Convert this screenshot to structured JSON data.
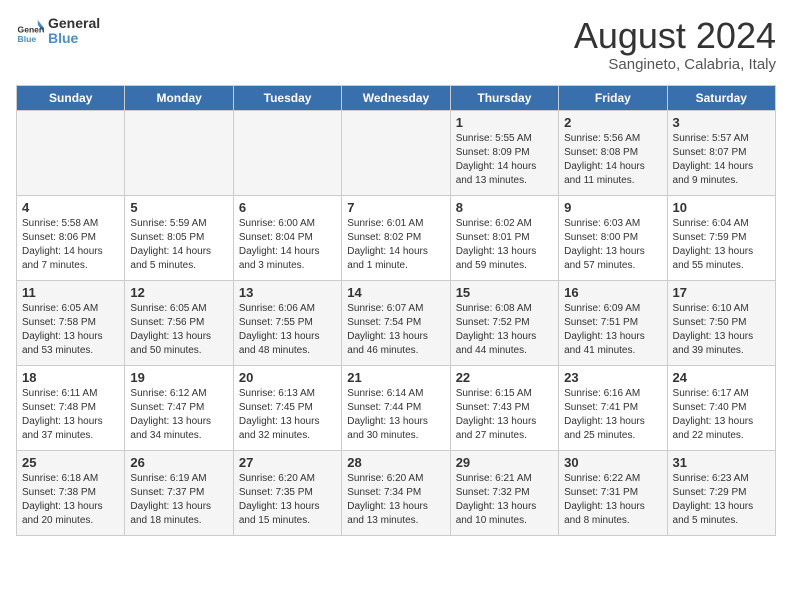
{
  "header": {
    "logo_line1": "General",
    "logo_line2": "Blue",
    "title": "August 2024",
    "subtitle": "Sangineto, Calabria, Italy"
  },
  "weekdays": [
    "Sunday",
    "Monday",
    "Tuesday",
    "Wednesday",
    "Thursday",
    "Friday",
    "Saturday"
  ],
  "weeks": [
    [
      {
        "day": "",
        "info": ""
      },
      {
        "day": "",
        "info": ""
      },
      {
        "day": "",
        "info": ""
      },
      {
        "day": "",
        "info": ""
      },
      {
        "day": "1",
        "info": "Sunrise: 5:55 AM\nSunset: 8:09 PM\nDaylight: 14 hours\nand 13 minutes."
      },
      {
        "day": "2",
        "info": "Sunrise: 5:56 AM\nSunset: 8:08 PM\nDaylight: 14 hours\nand 11 minutes."
      },
      {
        "day": "3",
        "info": "Sunrise: 5:57 AM\nSunset: 8:07 PM\nDaylight: 14 hours\nand 9 minutes."
      }
    ],
    [
      {
        "day": "4",
        "info": "Sunrise: 5:58 AM\nSunset: 8:06 PM\nDaylight: 14 hours\nand 7 minutes."
      },
      {
        "day": "5",
        "info": "Sunrise: 5:59 AM\nSunset: 8:05 PM\nDaylight: 14 hours\nand 5 minutes."
      },
      {
        "day": "6",
        "info": "Sunrise: 6:00 AM\nSunset: 8:04 PM\nDaylight: 14 hours\nand 3 minutes."
      },
      {
        "day": "7",
        "info": "Sunrise: 6:01 AM\nSunset: 8:02 PM\nDaylight: 14 hours\nand 1 minute."
      },
      {
        "day": "8",
        "info": "Sunrise: 6:02 AM\nSunset: 8:01 PM\nDaylight: 13 hours\nand 59 minutes."
      },
      {
        "day": "9",
        "info": "Sunrise: 6:03 AM\nSunset: 8:00 PM\nDaylight: 13 hours\nand 57 minutes."
      },
      {
        "day": "10",
        "info": "Sunrise: 6:04 AM\nSunset: 7:59 PM\nDaylight: 13 hours\nand 55 minutes."
      }
    ],
    [
      {
        "day": "11",
        "info": "Sunrise: 6:05 AM\nSunset: 7:58 PM\nDaylight: 13 hours\nand 53 minutes."
      },
      {
        "day": "12",
        "info": "Sunrise: 6:05 AM\nSunset: 7:56 PM\nDaylight: 13 hours\nand 50 minutes."
      },
      {
        "day": "13",
        "info": "Sunrise: 6:06 AM\nSunset: 7:55 PM\nDaylight: 13 hours\nand 48 minutes."
      },
      {
        "day": "14",
        "info": "Sunrise: 6:07 AM\nSunset: 7:54 PM\nDaylight: 13 hours\nand 46 minutes."
      },
      {
        "day": "15",
        "info": "Sunrise: 6:08 AM\nSunset: 7:52 PM\nDaylight: 13 hours\nand 44 minutes."
      },
      {
        "day": "16",
        "info": "Sunrise: 6:09 AM\nSunset: 7:51 PM\nDaylight: 13 hours\nand 41 minutes."
      },
      {
        "day": "17",
        "info": "Sunrise: 6:10 AM\nSunset: 7:50 PM\nDaylight: 13 hours\nand 39 minutes."
      }
    ],
    [
      {
        "day": "18",
        "info": "Sunrise: 6:11 AM\nSunset: 7:48 PM\nDaylight: 13 hours\nand 37 minutes."
      },
      {
        "day": "19",
        "info": "Sunrise: 6:12 AM\nSunset: 7:47 PM\nDaylight: 13 hours\nand 34 minutes."
      },
      {
        "day": "20",
        "info": "Sunrise: 6:13 AM\nSunset: 7:45 PM\nDaylight: 13 hours\nand 32 minutes."
      },
      {
        "day": "21",
        "info": "Sunrise: 6:14 AM\nSunset: 7:44 PM\nDaylight: 13 hours\nand 30 minutes."
      },
      {
        "day": "22",
        "info": "Sunrise: 6:15 AM\nSunset: 7:43 PM\nDaylight: 13 hours\nand 27 minutes."
      },
      {
        "day": "23",
        "info": "Sunrise: 6:16 AM\nSunset: 7:41 PM\nDaylight: 13 hours\nand 25 minutes."
      },
      {
        "day": "24",
        "info": "Sunrise: 6:17 AM\nSunset: 7:40 PM\nDaylight: 13 hours\nand 22 minutes."
      }
    ],
    [
      {
        "day": "25",
        "info": "Sunrise: 6:18 AM\nSunset: 7:38 PM\nDaylight: 13 hours\nand 20 minutes."
      },
      {
        "day": "26",
        "info": "Sunrise: 6:19 AM\nSunset: 7:37 PM\nDaylight: 13 hours\nand 18 minutes."
      },
      {
        "day": "27",
        "info": "Sunrise: 6:20 AM\nSunset: 7:35 PM\nDaylight: 13 hours\nand 15 minutes."
      },
      {
        "day": "28",
        "info": "Sunrise: 6:20 AM\nSunset: 7:34 PM\nDaylight: 13 hours\nand 13 minutes."
      },
      {
        "day": "29",
        "info": "Sunrise: 6:21 AM\nSunset: 7:32 PM\nDaylight: 13 hours\nand 10 minutes."
      },
      {
        "day": "30",
        "info": "Sunrise: 6:22 AM\nSunset: 7:31 PM\nDaylight: 13 hours\nand 8 minutes."
      },
      {
        "day": "31",
        "info": "Sunrise: 6:23 AM\nSunset: 7:29 PM\nDaylight: 13 hours\nand 5 minutes."
      }
    ]
  ]
}
